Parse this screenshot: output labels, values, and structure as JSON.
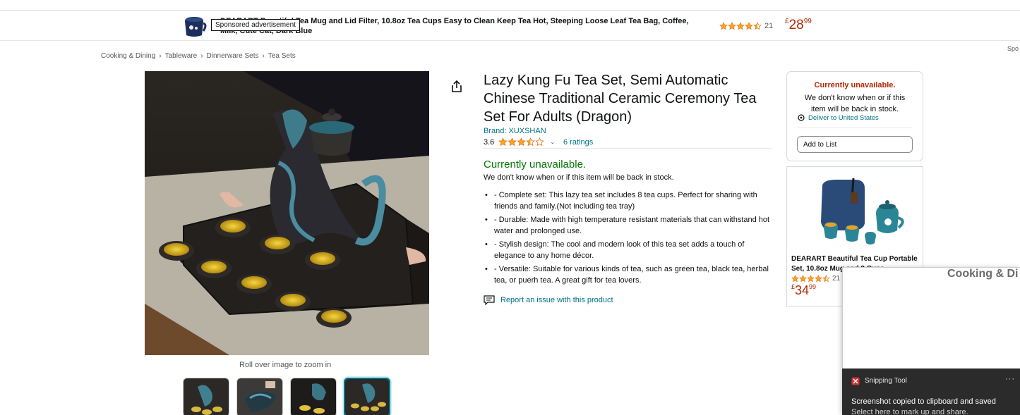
{
  "banner": {
    "title": "DEARART Beautiful Tea Mug and Lid Filter, 10.8oz Tea Cups Easy to Clean Keep Tea Hot, Steeping Loose Leaf Tea Bag, Coffee, Milk, Cute Cat, Dark Blue",
    "sponsored_tooltip": "Sponsored advertisement",
    "rating": 4.5,
    "rating_count": "21",
    "price_currency": "£",
    "price_whole": "28",
    "price_fraction": "99",
    "edge_label": "Spo"
  },
  "breadcrumb": [
    "Cooking & Dining",
    "Tableware",
    "Dinnerware Sets",
    "Tea Sets"
  ],
  "breadcrumb_separator": "›",
  "product": {
    "title": "Lazy Kung Fu Tea Set, Semi Automatic Chinese Traditional Ceramic Ceremony Tea Set For Adults (Dragon)",
    "brand": "Brand: XUXSHAN",
    "rating_value": "3.6",
    "rating": 3.5,
    "ratings_link": "6 ratings",
    "availability": "Currently unavailable.",
    "availability_sub": "We don't know when or if this item will be back in stock.",
    "bullets": [
      "- Complete set: This lazy tea set includes 8 tea cups. Perfect for sharing with friends and family.(Not including tea tray)",
      "- Durable: Made with high temperature resistant materials that can withstand hot water and prolonged use.",
      "- Stylish design: The cool and modern look of this tea set adds a touch of elegance to any home décor.",
      "- Versatile: Suitable for various kinds of tea, such as green tea, black tea, herbal tea, or puerh tea. A great gift for tea lovers."
    ],
    "report_link": "Report an issue with this product"
  },
  "gallery": {
    "zoom_hint": "Roll over image to zoom in",
    "thumbnail_count": 4,
    "active_thumbnail": 4
  },
  "buybox": {
    "unavailable": "Currently unavailable.",
    "unavailable_sub": "We don't know when or if this item will be back in stock.",
    "deliver": "Deliver to United States",
    "add_to_list": "Add to List"
  },
  "sponsored_card": {
    "title": "DEARART Beautiful Tea Cup Portable Set, 10.8oz Mug and 2 Cups",
    "rating": 4.5,
    "rating_count": "21",
    "price_currency": "£",
    "price_whole": "34",
    "price_fraction": "99"
  },
  "overlay": {
    "heading": "Cooking & Di"
  },
  "toast": {
    "app_name": "Snipping Tool",
    "more": "···",
    "message": "Screenshot copied to clipboard and saved",
    "sub": "Select here to mark up and share."
  },
  "colors": {
    "link": "#007185",
    "price": "#b12704",
    "in_stock_green": "#007600",
    "star": "#ffa41c",
    "toast_bg": "#2b2b2b"
  }
}
